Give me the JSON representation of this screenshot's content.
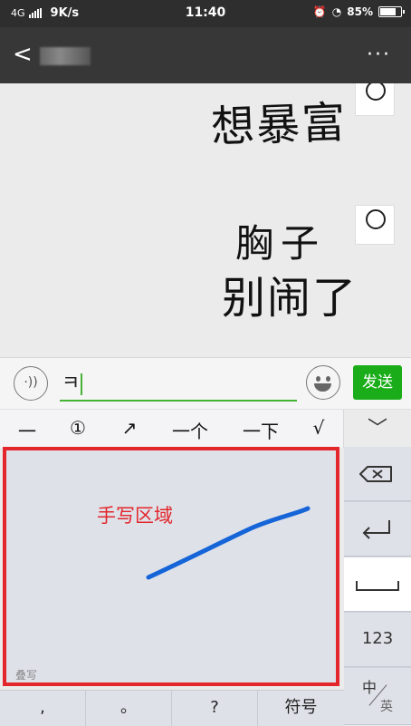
{
  "status_bar": {
    "network": "4G",
    "speed": "9K/s",
    "time": "11:40",
    "battery": "85%",
    "battery_level": 0.85
  },
  "chat": {
    "messages": [
      {
        "text": "想暴富"
      },
      {
        "text": "胸子"
      },
      {
        "text": "别闹了"
      }
    ]
  },
  "input": {
    "value": "ㅋ"
  },
  "send_label": "发送",
  "candidates": [
    "一",
    "①",
    "↗",
    "一个",
    "一下",
    "√"
  ],
  "handwriting": {
    "label": "手写区域",
    "stack_label": "叠写",
    "stroke_color": "#1565d8"
  },
  "bottom_keys": [
    ",",
    "。",
    "?",
    "符号"
  ],
  "side_keys": {
    "num_label": "123",
    "lang_zh": "中",
    "lang_en": "英"
  },
  "colors": {
    "accent_green": "#1aad19",
    "highlight_red": "#e2262b"
  }
}
